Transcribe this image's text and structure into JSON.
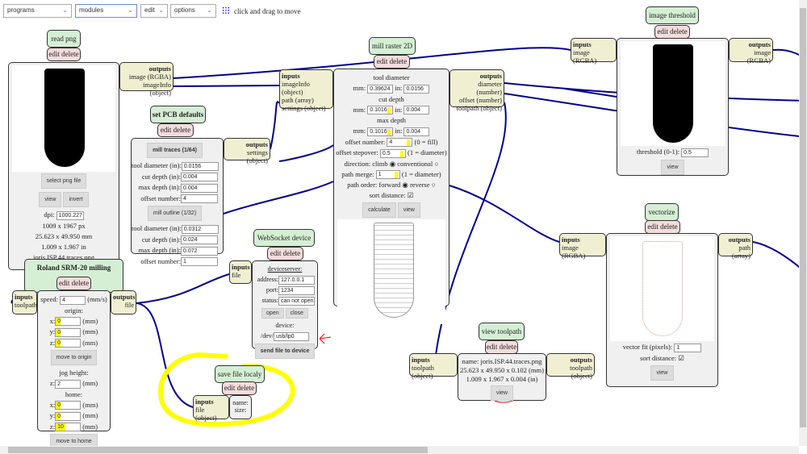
{
  "toolbar": {
    "programs": "programs",
    "modules": "modules",
    "edit": "edit",
    "options": "options",
    "move_hint": "click and drag to move"
  },
  "read_png": {
    "title": "read png",
    "edit_delete": "edit delete",
    "select": "select png file",
    "view": "view",
    "invert": "invert",
    "dpi_label": "dpi:",
    "dpi": "1000.227",
    "px": "1009 x 1967 px",
    "mm": "25.623 x 49.950 mm",
    "in": "1.009 x 1.967 in",
    "file": "joris.ISP.44.traces.png",
    "outputs": {
      "title": "outputs",
      "items": [
        "image (RGBA)",
        "imageInfo (object)"
      ]
    }
  },
  "pcb": {
    "title": "set PCB defaults",
    "edit_delete": "edit delete",
    "traces": "mill traces (1/64)",
    "outline": "mill outline (1/32)",
    "fields1": [
      {
        "label": "tool diameter (in):",
        "value": "0.0156"
      },
      {
        "label": "cut depth (in):",
        "value": "0.004"
      },
      {
        "label": "max depth (in):",
        "value": "0.004"
      },
      {
        "label": "offset number:",
        "value": "4"
      }
    ],
    "fields2": [
      {
        "label": "tool diameter (in):",
        "value": "0.0312"
      },
      {
        "label": "cut depth (in):",
        "value": "0.024"
      },
      {
        "label": "max depth (in):",
        "value": "0.072"
      },
      {
        "label": "offset number:",
        "value": "1"
      }
    ],
    "outputs": {
      "title": "outputs",
      "items": [
        "settings (object)"
      ]
    }
  },
  "roland": {
    "title": "Roland SRM-20 milling machine",
    "edit_delete": "edit delete",
    "speed_label": "speed:",
    "speed": "4",
    "speed_unit": "(mm/s)",
    "origin": "origin:",
    "ox": "0",
    "oy": "0",
    "oz": "0",
    "mm": "(mm)",
    "move_origin": "move to origin",
    "jog": "jog height:",
    "jz": "2",
    "home": "home:",
    "hx": "0",
    "hy": "0",
    "hz": "10",
    "move_home": "move to home",
    "x": "x:",
    "y": "y:",
    "z": "z:",
    "inputs": {
      "title": "inputs",
      "items": [
        "toolpath"
      ]
    },
    "outputs": {
      "title": "outputs",
      "items": [
        "file"
      ]
    }
  },
  "ws": {
    "title": "WebSocket device",
    "edit_delete": "edit delete",
    "server": "deviceserver:",
    "address_label": "address:",
    "address": "127.0.0.1",
    "port_label": "port:",
    "port": "1234",
    "status_label": "status:",
    "status": "can not open s",
    "open": "open",
    "close": "close",
    "device": "device:",
    "dev_prefix": "/dev/",
    "dev": "usb/lp0",
    "send": "send file to device",
    "inputs": {
      "title": "inputs",
      "items": [
        "file"
      ]
    }
  },
  "save": {
    "title": "save file localy",
    "edit_delete": "edit delete",
    "name": "name:",
    "size": "size:",
    "inputs": {
      "title": "inputs",
      "items": [
        "file (object)"
      ]
    }
  },
  "raster": {
    "title": "mill raster 2D",
    "edit_delete": "edit delete",
    "tool_diameter": "tool diameter",
    "cut_depth": "cut depth",
    "max_depth": "max depth",
    "mm": "mm:",
    "in": "in:",
    "td_mm": "0.39624",
    "td_in": "0.0156",
    "cd_mm": "0.1016",
    "cd_in": "0.004",
    "md_mm": "0.1016",
    "md_in": "0.004",
    "offset_label": "offset number:",
    "offset": "4",
    "offset_hint": "(0 = fill)",
    "stepover_label": "offset stepover:",
    "stepover": "0.5",
    "stepover_hint": "(1 = diameter)",
    "direction": "direction: climb",
    "conventional": "conventional",
    "merge_label": "path merge:",
    "merge": "1",
    "merge_hint": "(1 = diameter)",
    "order": "path order: forward",
    "reverse": "reverse",
    "sort": "sort distance:",
    "calculate": "calculate",
    "view": "view",
    "inputs": {
      "title": "inputs",
      "items": [
        "imageInfo (object)",
        "path (array)",
        "settings (object)"
      ]
    },
    "outputs": {
      "title": "outputs",
      "items": [
        "diameter (number)",
        "offset (number)",
        "toolpath (object)"
      ]
    }
  },
  "viewtp": {
    "title": "view toolpath",
    "edit_delete": "edit delete",
    "name": "name: joris.ISP.44.traces.png",
    "mm": "25.623 x 49.950 x 0.102 (mm)",
    "in": "1.009 x 1.967 x 0.004 (in)",
    "view": "view",
    "inputs": {
      "title": "inputs",
      "items": [
        "toolpath (object)"
      ]
    },
    "outputs": {
      "title": "outputs",
      "items": [
        "toolpath (object)"
      ]
    }
  },
  "threshold": {
    "title": "image threshold",
    "edit_delete": "edit delete",
    "label": "threshold (0-1):",
    "value": "0.5",
    "view": "view",
    "inputs": {
      "title": "inputs",
      "items": [
        "image (RGBA)"
      ]
    },
    "outputs": {
      "title": "outputs",
      "items": [
        "image (RGBA)"
      ]
    }
  },
  "vectorize": {
    "title": "vectorize",
    "edit_delete": "edit delete",
    "fit_label": "vector fit (pixels):",
    "fit": "1",
    "sort": "sort distance:",
    "view": "view",
    "inputs": {
      "title": "inputs",
      "items": [
        "image (RGBA)"
      ]
    },
    "outputs": {
      "title": "outputs",
      "items": [
        "path (array)"
      ]
    }
  },
  "colors": {
    "wire": "#00008b",
    "title_bg": "#d5efd5",
    "edit_bg": "#f3dcdc",
    "port_bg": "#f0efd2",
    "annotation_red": "#e00000",
    "annotation_yellow": "#ffff00"
  }
}
